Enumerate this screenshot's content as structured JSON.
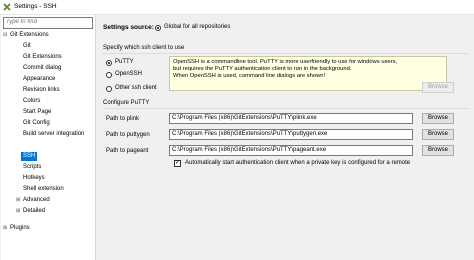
{
  "window": {
    "title": "Settings - SSH"
  },
  "search": {
    "placeholder": "Type to find"
  },
  "tree": {
    "git_extensions": "Git Extensions",
    "items": [
      "Git",
      "Git Extensions",
      "Commit dialog",
      "Appearance",
      "Revision links",
      "Colors",
      "Start Page",
      "Git Config",
      "Build server integration",
      "SSH",
      "Scripts",
      "Hotkeys",
      "Shell extension",
      "Advanced",
      "Detailed"
    ],
    "plugins": "Plugins"
  },
  "settings_source": {
    "label": "Settings source:",
    "option": "Global for all repositories"
  },
  "ssh_client": {
    "legend": "Specify which ssh client to use",
    "putty": "PuTTY",
    "openssh": "OpenSSH",
    "other": "Other ssh client",
    "hint": [
      "OpenSSH is a commandline tool. PuTTY is more userfriendly to use for windows users,",
      "but requires the PuTTY authentication client to run in the background.",
      "When OpenSSH is used, command line dialogs are shown!"
    ],
    "browse": "Browse"
  },
  "configure_putty": {
    "legend": "Configure PuTTY",
    "plink_label": "Path to plink",
    "plink_value": "C:\\Program Files (x86)\\GitExtensions\\PuTTY\\plink.exe",
    "puttygen_label": "Path to puttygen",
    "puttygen_value": "C:\\Program Files (x86)\\GitExtensions\\PuTTY\\puttygen.exe",
    "pageant_label": "Path to pageant",
    "pageant_value": "C:\\Program Files (x86)\\GitExtensions\\PuTTY\\pageant.exe",
    "browse": "Browse",
    "autostart": "Automatically start authentication client when a private key is configured for a remote"
  },
  "colors": {
    "selection": "#0078d7",
    "hint_bg": "#ffffe1"
  }
}
